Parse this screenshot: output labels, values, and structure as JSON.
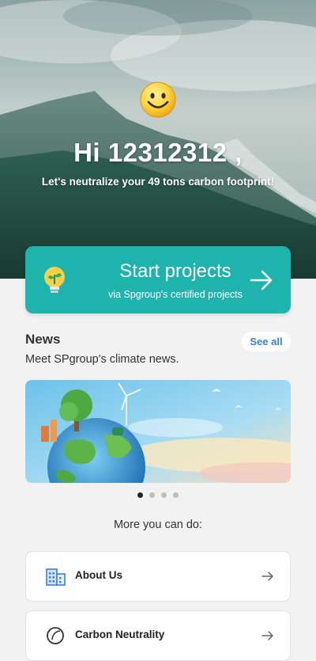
{
  "header": {
    "emoji": "😊",
    "greeting": "Hi 12312312 ,",
    "subtitle": "Let's neutralize your 49 tons carbon footprint!"
  },
  "start_card": {
    "title": "Start projects",
    "subtitle": "via Spgroup's certified projects",
    "accent": "#1fb3ad"
  },
  "news": {
    "title": "News",
    "description": "Meet SPgroup's climate news.",
    "see_all": "See all",
    "carousel": {
      "current": 1,
      "total": 4
    }
  },
  "more": {
    "heading": "More you can do:",
    "items": [
      {
        "label": "About Us",
        "icon": "building-icon"
      },
      {
        "label": "Carbon Neutrality",
        "icon": "leaf-icon"
      }
    ]
  }
}
